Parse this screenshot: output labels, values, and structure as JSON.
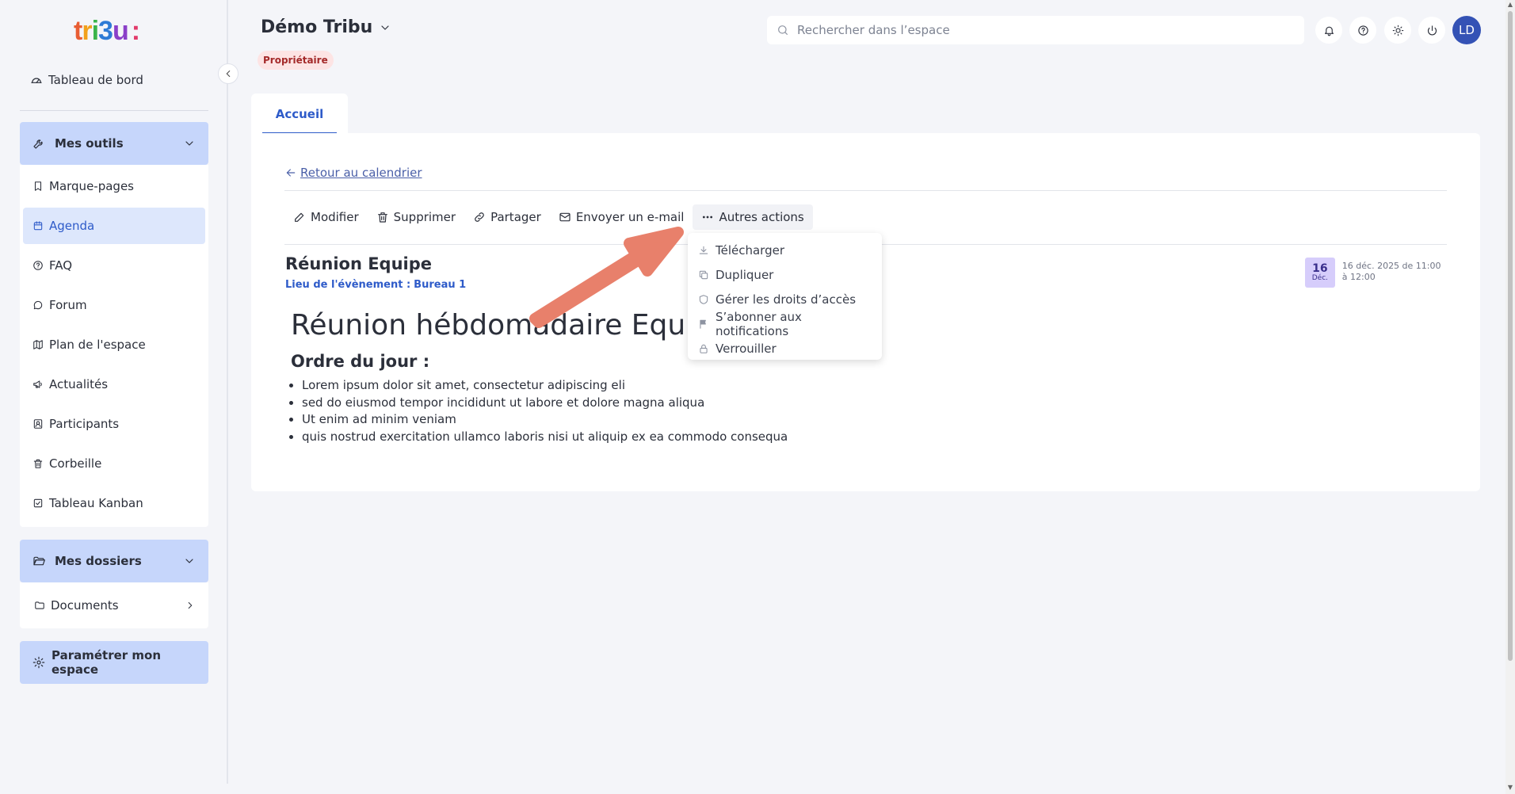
{
  "brand": {
    "logo_letters": [
      "t",
      "r",
      "i",
      "3",
      "u",
      ":"
    ],
    "logo_colors": [
      "#e85d34",
      "#f2a11c",
      "#3bb44a",
      "#2e7bd6",
      "#8a3fc8",
      "#e13b6b"
    ]
  },
  "sidebar": {
    "dashboard_label": "Tableau de bord",
    "tools_header": "Mes outils",
    "tools": [
      {
        "label": "Marque-pages",
        "icon": "bookmark-icon"
      },
      {
        "label": "Agenda",
        "icon": "calendar-icon",
        "active": true
      },
      {
        "label": "FAQ",
        "icon": "help-circle-icon"
      },
      {
        "label": "Forum",
        "icon": "chat-icon"
      },
      {
        "label": "Plan de l'espace",
        "icon": "map-icon"
      },
      {
        "label": "Actualités",
        "icon": "megaphone-icon"
      },
      {
        "label": "Participants",
        "icon": "contacts-icon"
      },
      {
        "label": "Corbeille",
        "icon": "trash-icon"
      },
      {
        "label": "Tableau Kanban",
        "icon": "checkbox-icon"
      }
    ],
    "folders_header": "Mes dossiers",
    "folders": [
      {
        "label": "Documents",
        "icon": "folder-icon"
      }
    ],
    "settings_label": "Paramétrer mon espace"
  },
  "header": {
    "space_title": "Démo Tribu",
    "role_badge": "Propriétaire",
    "search_placeholder": "Rechercher dans l’espace",
    "avatar_initials": "LD"
  },
  "tabs": [
    {
      "label": "Accueil",
      "active": true
    }
  ],
  "content": {
    "back_label": "Retour au calendrier",
    "actions": {
      "edit": "Modifier",
      "delete": "Supprimer",
      "share": "Partager",
      "email": "Envoyer un e-mail",
      "more": "Autres actions"
    },
    "more_menu": [
      {
        "label": "Télécharger",
        "icon": "download-icon"
      },
      {
        "label": "Dupliquer",
        "icon": "copy-icon"
      },
      {
        "label": "Gérer les droits d’accès",
        "icon": "shield-icon"
      },
      {
        "label": "S’abonner aux notifications",
        "icon": "flag-icon"
      },
      {
        "label": "Verrouiller",
        "icon": "lock-icon"
      }
    ],
    "event": {
      "title": "Réunion Equipe",
      "place_label": "Lieu de l'évènement :",
      "place_value": "Bureau 1",
      "day": "16",
      "month": "Déc.",
      "datetime": "16 déc. 2025 de 11:00 à 12:00"
    },
    "body": {
      "heading": "Réunion hébdomadaire Equipe",
      "agenda_heading": "Ordre du jour :",
      "items": [
        "Lorem ipsum dolor sit amet, consectetur adipiscing eli",
        "sed do eiusmod tempor incididunt ut labore et dolore magna aliqua",
        "Ut enim ad minim veniam",
        "quis nostrud exercitation ullamco laboris nisi ut aliquip ex ea commodo consequa"
      ]
    }
  },
  "colors": {
    "accent": "#2e5bc9",
    "sidebar_group": "#c6d6fb",
    "badge_bg": "#fde4e4",
    "arrow": "#e8806b"
  }
}
